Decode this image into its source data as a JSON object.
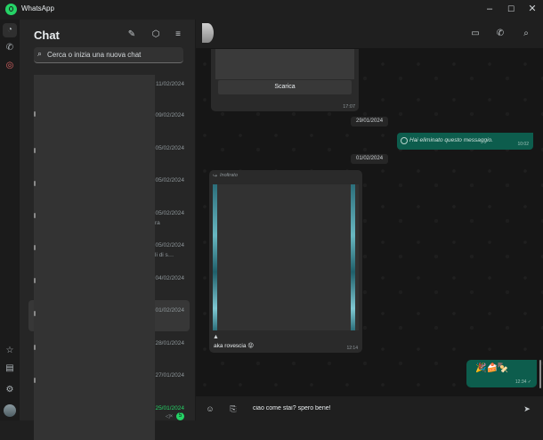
{
  "window": {
    "title": "WhatsApp",
    "minimize": "–",
    "maximize": "☐",
    "close": "✕"
  },
  "rail": {
    "chats_icon": "◔",
    "calls_icon": "✆",
    "status_icon": "◎",
    "starred_icon": "☆",
    "archive_icon": "▤",
    "settings_icon": "⚙"
  },
  "chatlist": {
    "title": "Chat",
    "new_chat_icon": "✎",
    "filter_icon": "⬡",
    "menu_icon": "≡",
    "search": {
      "placeholder": "Cerca o inizia una nuova chat",
      "icon": "⌕"
    },
    "rows": [
      {
        "date": "11/02/2024",
        "snippet": ""
      },
      {
        "date": "09/02/2024",
        "snippet": ""
      },
      {
        "date": "05/02/2024",
        "snippet": ""
      },
      {
        "date": "05/02/2024",
        "snippet": ""
      },
      {
        "date": "05/02/2024",
        "snippet": "ra"
      },
      {
        "date": "05/02/2024",
        "snippet": "li di s…"
      },
      {
        "date": "04/02/2024",
        "snippet": ""
      },
      {
        "date": "01/02/2024",
        "snippet": ""
      },
      {
        "date": "28/01/2024",
        "snippet": ""
      },
      {
        "date": "27/01/2024",
        "snippet": ""
      },
      {
        "date": "25/01/2024",
        "snippet": ""
      }
    ],
    "unread_count": "5",
    "mute_icon": "◁×",
    "accent": "#25d366"
  },
  "conversation": {
    "header": {
      "video_icon": "▭",
      "call_icon": "✆",
      "search_icon": "⌕"
    },
    "document": {
      "download_label": "Scarica",
      "time": "17:07"
    },
    "date_1": "29/01/2024",
    "deleted": {
      "text": "Hai eliminato questo messaggio.",
      "time": "10:02"
    },
    "date_2": "01/02/2024",
    "media": {
      "forwarded": "Inoltrato",
      "caption": "aka rovescia 😝",
      "time": "12:14",
      "play_icon": "▲"
    },
    "sticker": {
      "content": "🎉🍰🍢",
      "time": "12:34 ✓"
    },
    "composer": {
      "emoji_icon": "☺",
      "attach_icon": "⎘",
      "message": "ciao come stai? spero bene!",
      "send_icon": "➤"
    },
    "outgoing_color": "#0d5d4d"
  }
}
